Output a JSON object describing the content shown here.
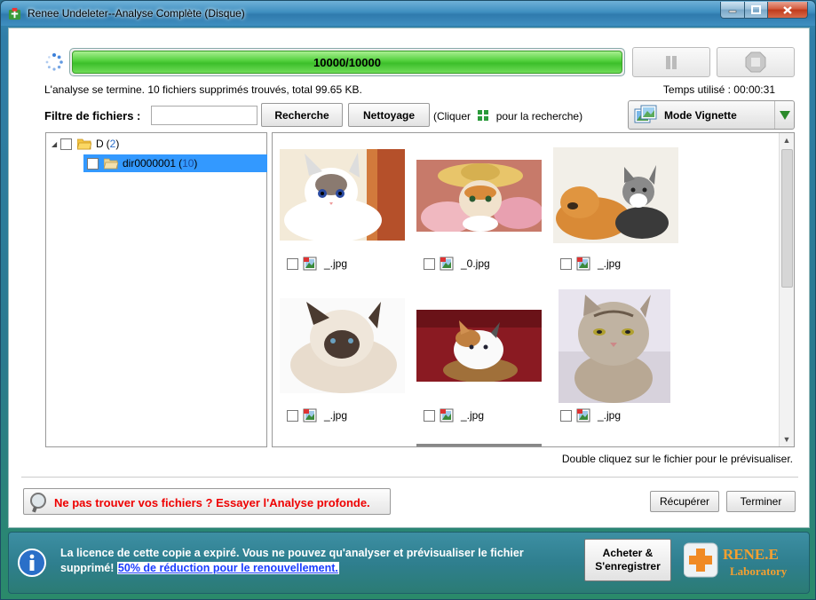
{
  "window": {
    "title": "Renee Undeleter--Analyse Complète (Disque)"
  },
  "progress": {
    "label": "10000/10000",
    "fraction": 1.0
  },
  "status": {
    "message": "L'analyse se termine. 10 fichiers supprimés trouvés, total 99.65 KB.",
    "time_used": "Temps utilisé : 00:00:31"
  },
  "filter": {
    "label": "Filtre de fichiers :",
    "value": "",
    "search_button": "Recherche",
    "clean_button": "Nettoyage",
    "hint_prefix": "(Cliquer",
    "hint_suffix": "pour la recherche)"
  },
  "view_mode": {
    "label": "Mode Vignette"
  },
  "tree": {
    "root": {
      "name": "D",
      "open_paren": "(",
      "count": "2",
      "close_paren": ")"
    },
    "child": {
      "name": "dir0000001",
      "open_paren": "(",
      "count": "10",
      "close_paren": ")"
    }
  },
  "thumbnails": [
    {
      "filename": "_.jpg",
      "subject": "white-blue-eyed-kitten"
    },
    {
      "filename": "_0.jpg",
      "subject": "kitten-in-straw-hat"
    },
    {
      "filename": "_.jpg",
      "subject": "puppy-and-kitten"
    },
    {
      "filename": "_.jpg",
      "subject": "ragdoll-cat"
    },
    {
      "filename": "_.jpg",
      "subject": "kitten-in-basket"
    },
    {
      "filename": "_.jpg",
      "subject": "grumpy-tabby-cat"
    }
  ],
  "preview_hint": "Double cliquez sur le fichier pour le prévisualiser.",
  "deep_scan": {
    "label": "Ne pas trouver vos fichiers ? Essayer l'Analyse profonde."
  },
  "actions": {
    "recover": "Récupérer",
    "finish": "Terminer"
  },
  "license": {
    "text": "La licence de cette copie a expiré. Vous ne pouvez qu'analyser et prévisualiser le fichier supprimé!",
    "link": "50% de réduction pour le renouvellement.",
    "buy_line1": "Acheter &",
    "buy_line2": "S'enregistrer",
    "logo_name": "RENE.E",
    "logo_sub": "Laboratory"
  },
  "colors": {
    "progress_green": "#4fcf3a",
    "selection_blue": "#3399ff",
    "count_blue": "#2b6ec9",
    "deep_scan_red": "#ee0000",
    "logo_orange": "#f08a24"
  }
}
